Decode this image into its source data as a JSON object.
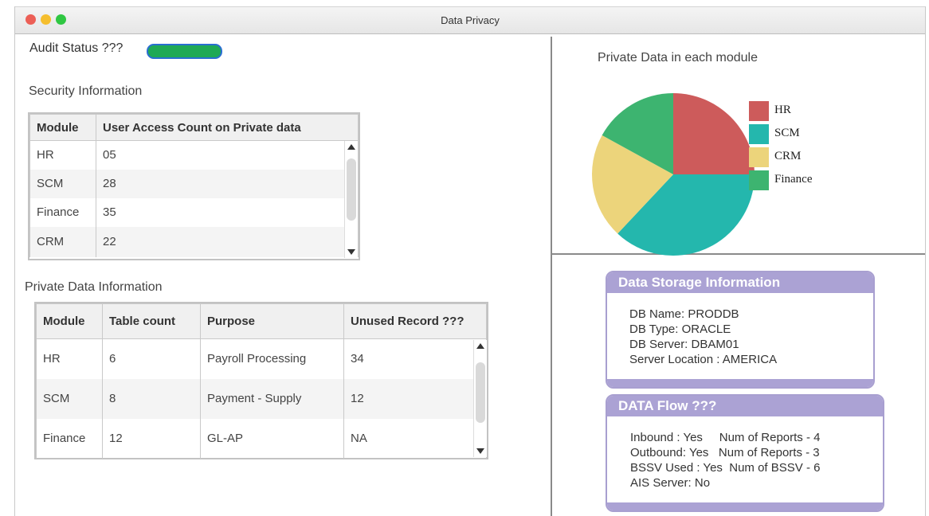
{
  "window": {
    "title": "Data Privacy"
  },
  "audit": {
    "label": "Audit Status ???",
    "status_color": "#1fa956"
  },
  "security": {
    "heading": "Security Information",
    "columns": [
      "Module",
      "User Access Count on Private data"
    ],
    "rows": [
      [
        "HR",
        "05"
      ],
      [
        "SCM",
        "28"
      ],
      [
        "Finance",
        "35"
      ],
      [
        "CRM",
        "22"
      ]
    ]
  },
  "private_data": {
    "heading": "Private Data Information",
    "columns": [
      "Module",
      "Table count",
      "Purpose",
      "Unused Record ???"
    ],
    "rows": [
      [
        "HR",
        "6",
        "Payroll  Processing",
        "34"
      ],
      [
        "SCM",
        "8",
        "Payment - Supply",
        "12"
      ],
      [
        "Finance",
        "12",
        "GL-AP",
        "NA"
      ]
    ]
  },
  "chart_data": {
    "type": "pie",
    "title": "Private Data in each module",
    "series": [
      {
        "name": "HR",
        "value": 25,
        "color": "#cd5b5b"
      },
      {
        "name": "SCM",
        "value": 37,
        "color": "#24b7ad"
      },
      {
        "name": "CRM",
        "value": 21,
        "color": "#ecd47b"
      },
      {
        "name": "Finance",
        "value": 17,
        "color": "#3db470"
      }
    ],
    "legend_position": "right"
  },
  "storage": {
    "title": "Data Storage Information",
    "lines": [
      "DB Name: PRODDB",
      "DB Type: ORACLE",
      "DB Server: DBAM01",
      "Server Location :  AMERICA"
    ]
  },
  "flow": {
    "title": "DATA Flow ???",
    "lines": [
      "Inbound : Yes     Num of Reports - 4",
      "Outbound: Yes   Num of Reports - 3",
      "BSSV Used : Yes  Num of BSSV - 6",
      "AIS Server: No"
    ]
  }
}
